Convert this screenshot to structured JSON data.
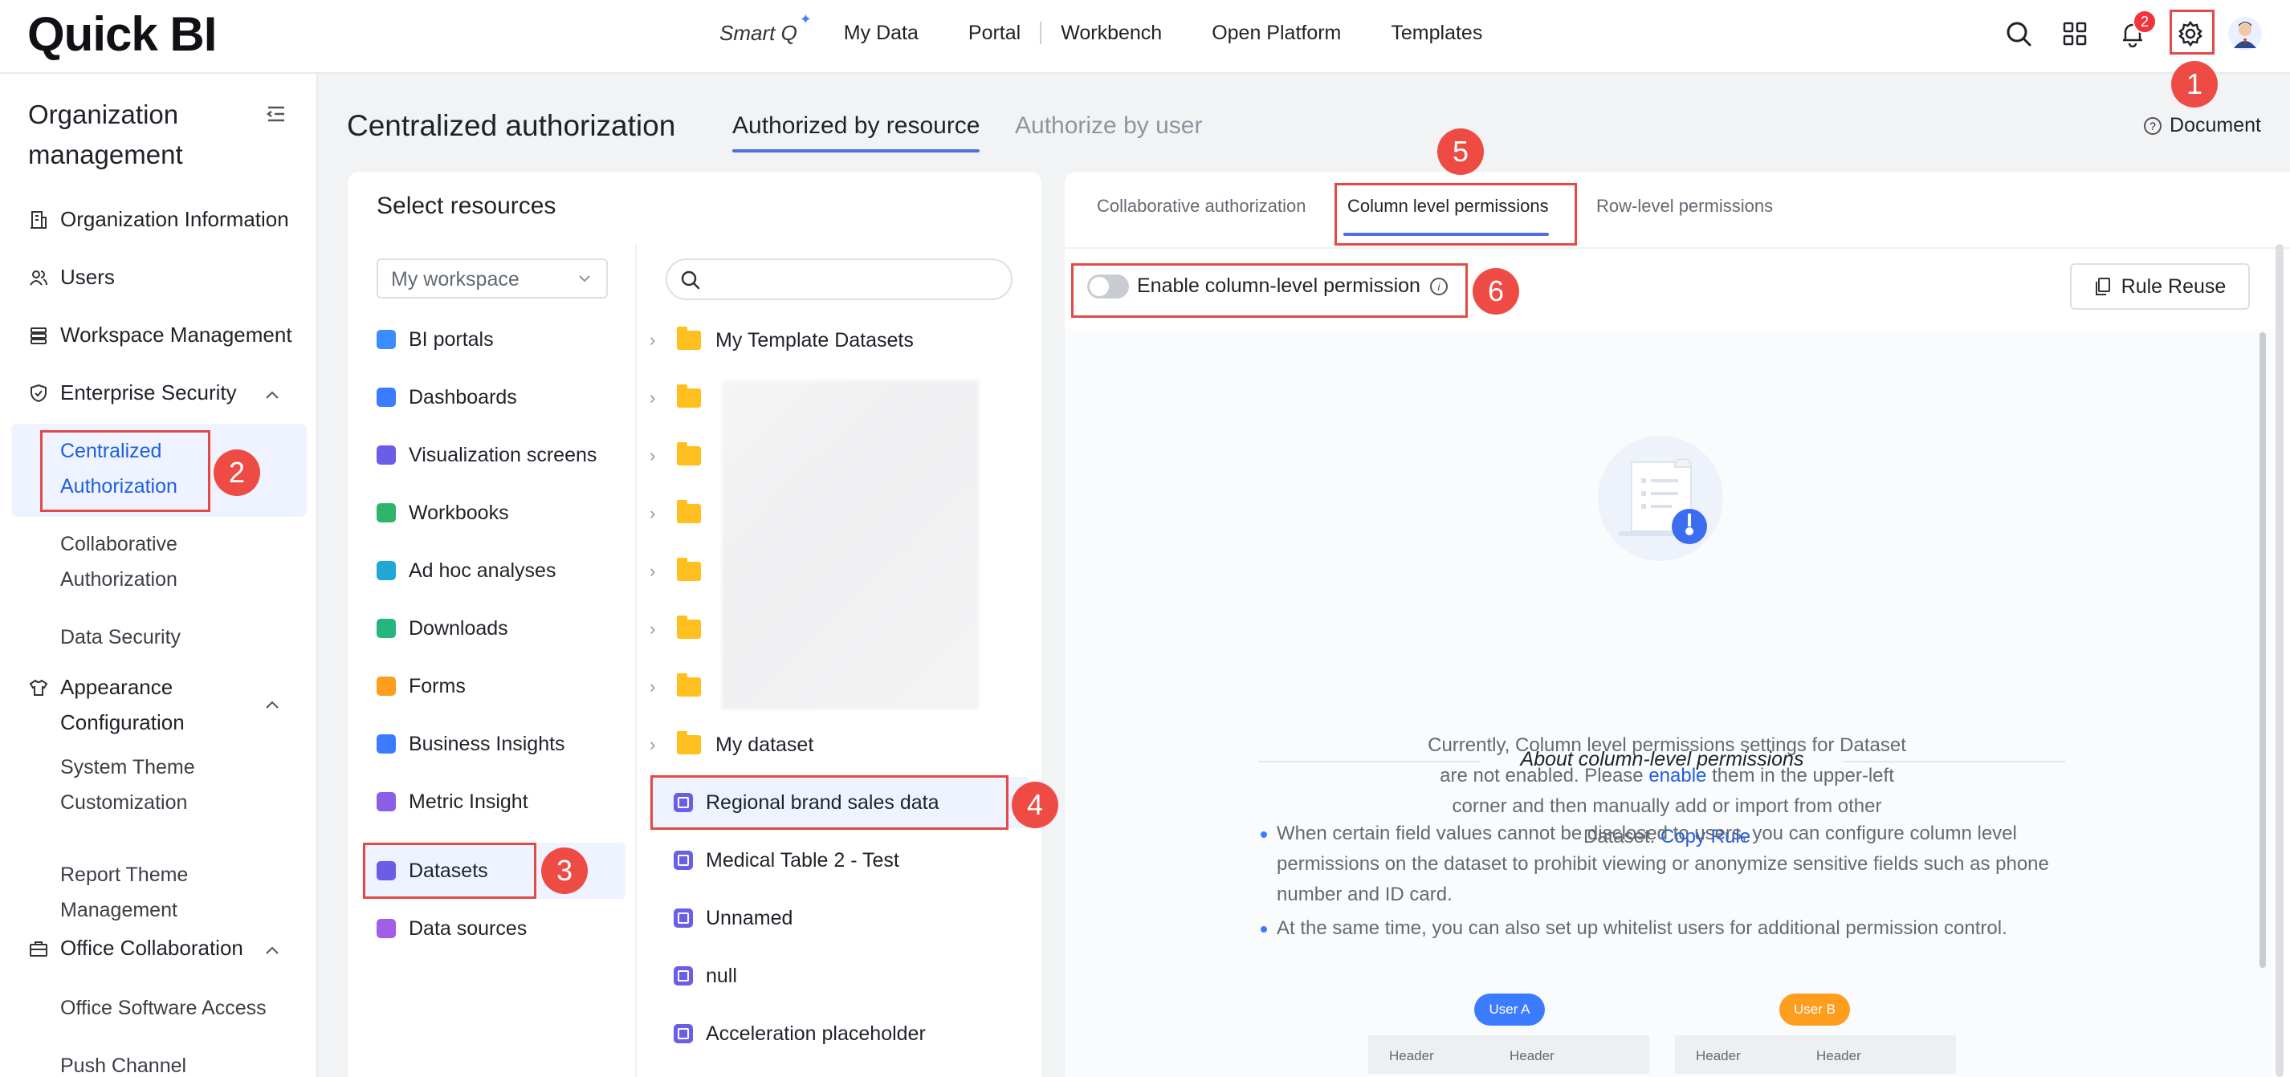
{
  "header": {
    "logo": "Quick BI",
    "nav": [
      "Smart Q",
      "My Data",
      "Portal",
      "Workbench",
      "Open Platform",
      "Templates"
    ],
    "notification_count": "2"
  },
  "sidebar": {
    "title_line1": "Organization",
    "title_line2": "management",
    "items": {
      "org_info": "Organization Information",
      "users": "Users",
      "workspace": "Workspace Management",
      "enterprise_security": "Enterprise Security",
      "centralized_auth_l1": "Centralized",
      "centralized_auth_l2": "Authorization",
      "collab_auth_l1": "Collaborative",
      "collab_auth_l2": "Authorization",
      "data_security": "Data Security",
      "appearance_l1": "Appearance",
      "appearance_l2": "Configuration",
      "system_theme_l1": "System Theme",
      "system_theme_l2": "Customization",
      "report_theme_l1": "Report Theme",
      "report_theme_l2": "Management",
      "office_collab": "Office Collaboration",
      "office_software": "Office Software Access",
      "push_channel": "Push Channel"
    }
  },
  "main": {
    "title": "Centralized authorization",
    "tabs": [
      "Authorized by resource",
      "Authorize by user"
    ],
    "document": "Document"
  },
  "resources": {
    "title": "Select resources",
    "workspace_select": "My workspace",
    "categories": [
      {
        "label": "BI portals",
        "color": "#3b8cff"
      },
      {
        "label": "Dashboards",
        "color": "#3b7cff"
      },
      {
        "label": "Visualization screens",
        "color": "#6a5ee8"
      },
      {
        "label": "Workbooks",
        "color": "#2fb56a"
      },
      {
        "label": "Ad hoc analyses",
        "color": "#1fa8d6"
      },
      {
        "label": "Downloads",
        "color": "#26b57d"
      },
      {
        "label": "Forms",
        "color": "#ff9d1f"
      },
      {
        "label": "Business Insights",
        "color": "#3b7cff"
      },
      {
        "label": "Metric Insight",
        "color": "#8c5ee8"
      },
      {
        "label": "Datasets",
        "color": "#6a5ee8"
      },
      {
        "label": "Data sources",
        "color": "#a35ee8"
      }
    ],
    "tree": {
      "folder_first": "My Template Datasets",
      "folder_last": "My dataset",
      "datasets": [
        "Regional brand sales data",
        "Medical Table 2 - Test",
        "Unnamed",
        "null",
        "Acceleration placeholder"
      ]
    }
  },
  "permissions": {
    "tabs": [
      "Collaborative authorization",
      "Column level permissions",
      "Row-level permissions"
    ],
    "enable_label": "Enable column-level permission",
    "rule_reuse": "Rule Reuse",
    "empty_text_1": "Currently, Column level permissions settings for Dataset are not enabled. Please ",
    "empty_link_enable": "enable",
    "empty_text_2": " them in the upper-left corner and then manually add or import from other Dataset. ",
    "empty_link_copy": "Copy Rule",
    "about_title": "About column-level permissions",
    "bullets": [
      "When certain field values cannot be disclosed to users, you can configure column level permissions on the dataset to prohibit viewing or anonymize sensitive fields such as phone number and ID card.",
      "At the same time, you can also set up whitelist users for additional permission control."
    ],
    "user_a": "User A",
    "user_b": "User B",
    "header_cell": "Header"
  },
  "callouts": [
    "1",
    "2",
    "3",
    "4",
    "5",
    "6"
  ],
  "colors": {
    "accent": "#1f5fe0",
    "callout": "#ef4b45",
    "badge": "#f2343f"
  }
}
